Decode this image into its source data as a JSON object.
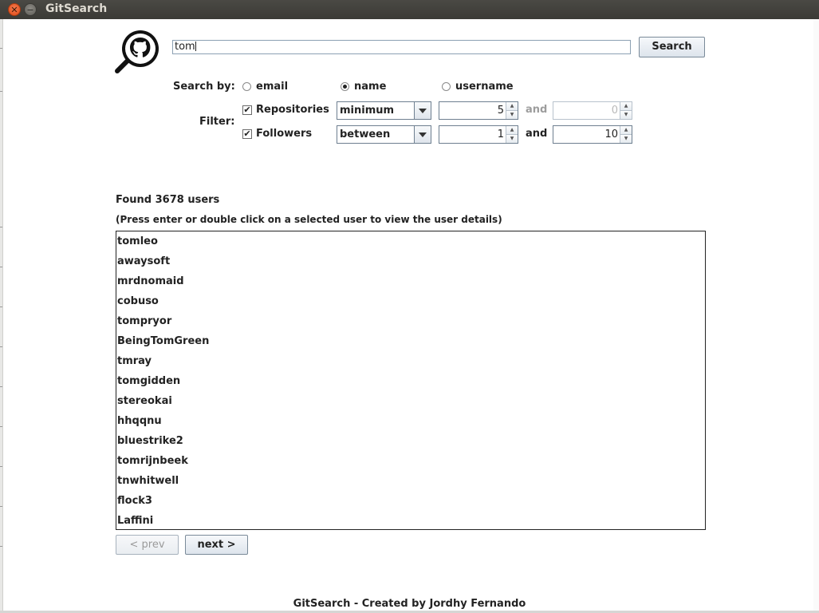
{
  "window": {
    "title": "GitSearch"
  },
  "search": {
    "query": "tom",
    "button_label": "Search"
  },
  "search_by": {
    "label": "Search by:",
    "options": [
      {
        "label": "email",
        "selected": false
      },
      {
        "label": "name",
        "selected": true
      },
      {
        "label": "username",
        "selected": false
      }
    ]
  },
  "filter": {
    "label": "Filter:",
    "rows": [
      {
        "label": "Repositories",
        "checked": true,
        "mode": "minimum",
        "min": "5",
        "and_label": "and",
        "max": "0",
        "max_enabled": false
      },
      {
        "label": "Followers",
        "checked": true,
        "mode": "between",
        "min": "1",
        "and_label": "and",
        "max": "10",
        "max_enabled": true
      }
    ]
  },
  "results": {
    "count_text": "Found 3678 users",
    "hint": "(Press enter or double click on a selected user to view the user details)",
    "users": [
      "tomleo",
      "awaysoft",
      "mrdnomaid",
      "cobuso",
      "tompryor",
      "BeingTomGreen",
      "tmray",
      "tomgidden",
      "stereokai",
      "hhqqnu",
      "bluestrike2",
      "tomrijnbeek",
      "tnwhitwell",
      "flock3",
      "Laffini"
    ]
  },
  "pagination": {
    "prev_label": "< prev",
    "next_label": "next >",
    "prev_enabled": false
  },
  "footer": "GitSearch - Created by Jordhy Fernando",
  "icons": {
    "close": "close-icon",
    "minimize": "minimize-icon",
    "logo": "github-search-logo",
    "check": "check-icon",
    "dropdown": "chevron-down-icon"
  }
}
